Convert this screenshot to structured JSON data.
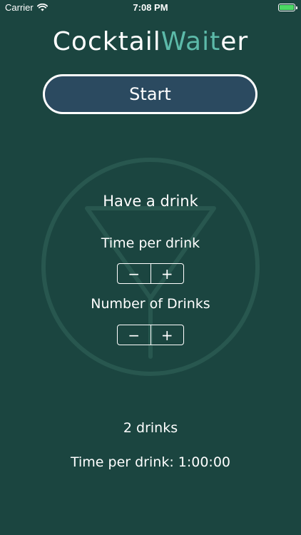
{
  "status_bar": {
    "carrier": "Carrier",
    "time": "7:08 PM"
  },
  "app": {
    "title_parts": [
      "Cocktail",
      "Wai",
      "t",
      "er"
    ],
    "accent_color": "#5cbaa9",
    "background_color": "#1b4540"
  },
  "start_button": {
    "label": "Start"
  },
  "section": {
    "title": "Have a drink",
    "time_per_drink_label": "Time per drink",
    "number_of_drinks_label": "Number of Drinks"
  },
  "stepper": {
    "minus_label": "−",
    "plus_label": "+"
  },
  "summary": {
    "drinks": "2 drinks",
    "time_per_drink": "Time per drink: 1:00:00"
  },
  "icons": [
    "wifi-icon",
    "battery-icon",
    "cocktail-glass-logo-icon"
  ]
}
